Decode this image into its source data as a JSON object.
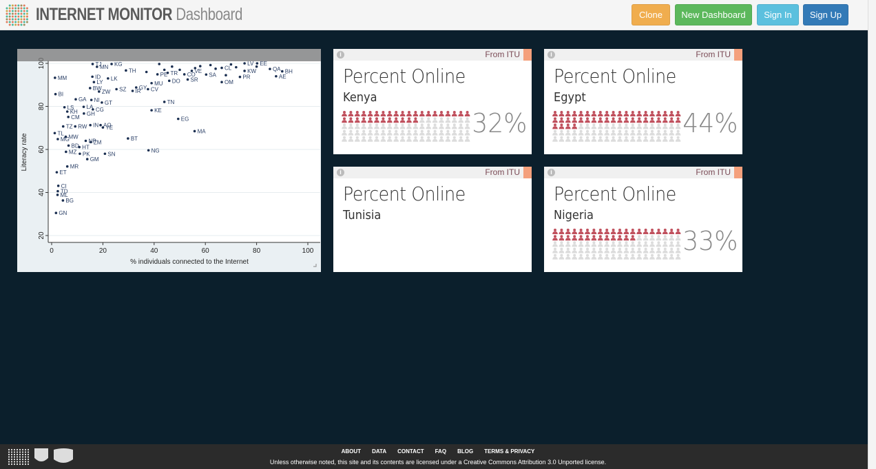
{
  "header": {
    "brand": "INTERNET MONITOR",
    "brand_sub": "Dashboard",
    "buttons": [
      {
        "label": "Clone",
        "color": "#f0ad4e"
      },
      {
        "label": "New Dashboard",
        "color": "#5cb85c"
      },
      {
        "label": "Sign In",
        "color": "#5bc0de"
      },
      {
        "label": "Sign Up",
        "color": "#337ab7"
      }
    ]
  },
  "chart_data": {
    "type": "scatter",
    "xlabel": "% individuals connected to the Internet",
    "ylabel": "Literacy rate",
    "xlim": [
      0,
      100
    ],
    "ylim": [
      20,
      100
    ],
    "xticks": [
      0,
      20,
      40,
      60,
      80,
      100
    ],
    "yticks": [
      20,
      40,
      60,
      80,
      100
    ],
    "grid": true,
    "points": [
      {
        "label": "MM",
        "x": 1.3,
        "y": 93.3
      },
      {
        "label": "TJ",
        "x": 16,
        "y": 99.7
      },
      {
        "label": "MN",
        "x": 17.7,
        "y": 98.4
      },
      {
        "label": "KG",
        "x": 23.4,
        "y": 99.7
      },
      {
        "label": "TH",
        "x": 29,
        "y": 96.7
      },
      {
        "label": "ID",
        "x": 15.9,
        "y": 93.8
      },
      {
        "label": "LK",
        "x": 22,
        "y": 93
      },
      {
        "label": "LY",
        "x": 16.5,
        "y": 91.3
      },
      {
        "label": "BW",
        "x": 15,
        "y": 88.5
      },
      {
        "label": "SZ",
        "x": 25.3,
        "y": 88
      },
      {
        "label": "ZW",
        "x": 18.5,
        "y": 86.9
      },
      {
        "label": "IR",
        "x": 31.6,
        "y": 87.2
      },
      {
        "label": "GY",
        "x": 33,
        "y": 88.8
      },
      {
        "label": "CV",
        "x": 37.6,
        "y": 88
      },
      {
        "label": "MU",
        "x": 39,
        "y": 90.8
      },
      {
        "label": "BI",
        "x": 1.5,
        "y": 85.7
      },
      {
        "label": "GA",
        "x": 9.4,
        "y": 83.3
      },
      {
        "label": "NI",
        "x": 15.5,
        "y": 83
      },
      {
        "label": "GT",
        "x": 19.6,
        "y": 81.8
      },
      {
        "label": "LS",
        "x": 5,
        "y": 79.6
      },
      {
        "label": "KH",
        "x": 6.1,
        "y": 77.6
      },
      {
        "label": "CM",
        "x": 6.5,
        "y": 75.1
      },
      {
        "label": "LA",
        "x": 12.5,
        "y": 79.8
      },
      {
        "label": "CG",
        "x": 16.1,
        "y": 78.6
      },
      {
        "label": "GH",
        "x": 12.6,
        "y": 76.7
      },
      {
        "label": "TZ",
        "x": 4.5,
        "y": 70.7
      },
      {
        "label": "RW",
        "x": 9.2,
        "y": 70.7
      },
      {
        "label": "IN",
        "x": 15.1,
        "y": 71.3
      },
      {
        "label": "AO",
        "x": 19.1,
        "y": 71.3
      },
      {
        "label": "YE",
        "x": 20,
        "y": 70.2
      },
      {
        "label": "TL",
        "x": 1.2,
        "y": 67.6
      },
      {
        "label": "MG",
        "x": 2.4,
        "y": 64.8
      },
      {
        "label": "MW",
        "x": 5.5,
        "y": 65.9
      },
      {
        "label": "NP",
        "x": 13.3,
        "y": 64
      },
      {
        "label": "ZM",
        "x": 15.3,
        "y": 63.4
      },
      {
        "label": "BT",
        "x": 29.8,
        "y": 65.1
      },
      {
        "label": "BD",
        "x": 6.6,
        "y": 61.8
      },
      {
        "label": "HT",
        "x": 10.8,
        "y": 61.1
      },
      {
        "label": "MZ",
        "x": 5.6,
        "y": 58.9
      },
      {
        "label": "PK",
        "x": 11,
        "y": 58
      },
      {
        "label": "SN",
        "x": 20.8,
        "y": 58
      },
      {
        "label": "GM",
        "x": 13.9,
        "y": 55.5
      },
      {
        "label": "NG",
        "x": 37.8,
        "y": 59.6
      },
      {
        "label": "MR",
        "x": 6.1,
        "y": 52.1
      },
      {
        "label": "ET",
        "x": 2,
        "y": 49.4
      },
      {
        "label": "CI",
        "x": 2.6,
        "y": 43.1
      },
      {
        "label": "TD",
        "x": 2.4,
        "y": 40.6
      },
      {
        "label": "ML",
        "x": 2.3,
        "y": 38.9
      },
      {
        "label": "BG",
        "x": 4.4,
        "y": 36.3
      },
      {
        "label": "GN",
        "x": 1.7,
        "y": 30.5
      },
      {
        "label": "KE",
        "x": 39,
        "y": 78.2
      },
      {
        "label": "TN",
        "x": 44,
        "y": 82.1
      },
      {
        "label": "EG",
        "x": 49.4,
        "y": 74.2
      },
      {
        "label": "MA",
        "x": 55.8,
        "y": 68.5
      },
      {
        "label": "DO",
        "x": 45.9,
        "y": 91.9
      },
      {
        "label": "SR",
        "x": 53.1,
        "y": 92.5
      },
      {
        "label": "OM",
        "x": 66.4,
        "y": 91.3
      },
      {
        "label": "EE",
        "x": 80.2,
        "y": 100
      },
      {
        "label": "QA",
        "x": 85.2,
        "y": 97.4
      },
      {
        "label": "BH",
        "x": 90,
        "y": 96.3
      },
      {
        "label": "AE",
        "x": 87.6,
        "y": 94
      },
      {
        "label": "PR",
        "x": 73.5,
        "y": 93.7
      },
      {
        "label": "KW",
        "x": 75.3,
        "y": 96.5
      },
      {
        "label": "LV",
        "x": 75.3,
        "y": 100
      },
      {
        "label": "SA",
        "x": 60.3,
        "y": 94.8
      },
      {
        "label": "CL",
        "x": 66.4,
        "y": 97.9
      },
      {
        "label": "VE",
        "x": 54.7,
        "y": 96.5
      },
      {
        "label": "CO",
        "x": 51.8,
        "y": 94.9
      },
      {
        "label": "PE",
        "x": 41.3,
        "y": 94.9
      },
      {
        "label": "TR",
        "x": 45.3,
        "y": 95.6
      },
      {
        "label": "",
        "x": 37,
        "y": 96
      },
      {
        "label": "",
        "x": 42,
        "y": 99.7
      },
      {
        "label": "",
        "x": 47,
        "y": 98.5
      },
      {
        "label": "",
        "x": 50,
        "y": 97
      },
      {
        "label": "",
        "x": 58,
        "y": 98.7
      },
      {
        "label": "",
        "x": 62,
        "y": 99.2
      },
      {
        "label": "",
        "x": 64,
        "y": 97.5
      },
      {
        "label": "",
        "x": 70,
        "y": 99.5
      },
      {
        "label": "",
        "x": 72,
        "y": 98.2
      },
      {
        "label": "",
        "x": 68,
        "y": 94.5
      },
      {
        "label": "",
        "x": 80,
        "y": 98.5
      },
      {
        "label": "",
        "x": 56,
        "y": 97.8
      },
      {
        "label": "",
        "x": 44,
        "y": 97
      }
    ]
  },
  "cards": [
    {
      "title": "Percent Online",
      "country": "Kenya",
      "value": 32,
      "value_label": "32%",
      "source": "From ITU"
    },
    {
      "title": "Percent Online",
      "country": "Egypt",
      "value": 44,
      "value_label": "44%",
      "source": "From ITU"
    },
    {
      "title": "Percent Online",
      "country": "Tunisia",
      "value": null,
      "value_label": "",
      "source": "From ITU"
    },
    {
      "title": "Percent Online",
      "country": "Nigeria",
      "value": 33,
      "value_label": "33%",
      "source": "From ITU"
    }
  ],
  "colors": {
    "filled": "#c0505d",
    "empty": "#dcdcdc",
    "background": "#0b1f2c"
  },
  "footer": {
    "links": [
      "ABOUT",
      "DATA",
      "CONTACT",
      "FAQ",
      "BLOG",
      "TERMS & PRIVACY"
    ],
    "license": "Unless otherwise noted, this site and its contents are licensed under a Creative Commons Attribution 3.0 Unported license."
  }
}
